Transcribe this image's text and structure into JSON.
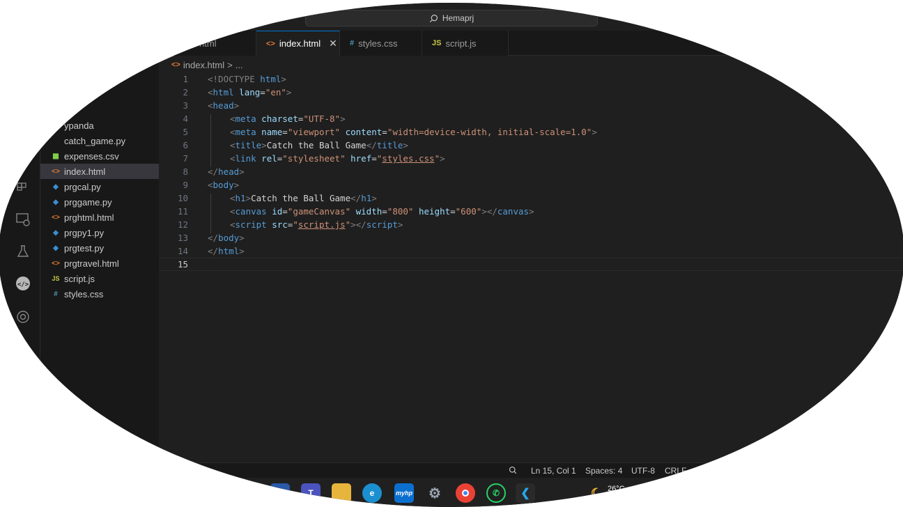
{
  "window": {
    "search_text": "Hemaprj"
  },
  "tabs": [
    {
      "label": "html",
      "icon": "html-file-icon"
    },
    {
      "label": "index.html",
      "icon": "html-file-icon",
      "close": "✕"
    },
    {
      "label": "styles.css",
      "icon": "css-file-icon"
    },
    {
      "label": "script.js",
      "icon": "js-file-icon"
    }
  ],
  "breadcrumb": {
    "file": "index.html",
    "sep": ">",
    "rest": "..."
  },
  "explorer": {
    "files": [
      {
        "label": "ypanda",
        "type": "folder"
      },
      {
        "label": "catch_game.py",
        "type": "py"
      },
      {
        "label": "expenses.csv",
        "type": "csv"
      },
      {
        "label": "index.html",
        "type": "html"
      },
      {
        "label": "prgcal.py",
        "type": "py"
      },
      {
        "label": "prggame.py",
        "type": "py"
      },
      {
        "label": "prghtml.html",
        "type": "html"
      },
      {
        "label": "prgpy1.py",
        "type": "py"
      },
      {
        "label": "prgtest.py",
        "type": "py"
      },
      {
        "label": "prgtravel.html",
        "type": "html"
      },
      {
        "label": "script.js",
        "type": "js"
      },
      {
        "label": "styles.css",
        "type": "css"
      }
    ]
  },
  "editor": {
    "line_numbers": [
      "1",
      "2",
      "3",
      "4",
      "5",
      "6",
      "7",
      "8",
      "9",
      "10",
      "11",
      "12",
      "13",
      "14",
      "15"
    ],
    "code": {
      "l1": {
        "a": "<!DOCTYPE ",
        "b": "html",
        "c": ">"
      },
      "l2": {
        "a": "<",
        "b": "html",
        "c": " lang",
        "d": "=",
        "e": "\"en\"",
        "f": ">"
      },
      "l3": {
        "a": "<",
        "b": "head",
        "c": ">"
      },
      "l4": {
        "a": "<",
        "b": "meta",
        "c": " charset",
        "d": "=",
        "e": "\"UTF-8\"",
        "f": ">"
      },
      "l5": {
        "a": "<",
        "b": "meta",
        "c": " name",
        "d": "=",
        "e": "\"viewport\"",
        "f": " content",
        "g": "=",
        "h": "\"width=device-width, initial-scale=1.0\"",
        "i": ">"
      },
      "l6": {
        "a": "<",
        "b": "title",
        "c": ">",
        "d": "Catch the Ball Game",
        "e": "</",
        "f": "title",
        "g": ">"
      },
      "l7": {
        "a": "<",
        "b": "link",
        "c": " rel",
        "d": "=",
        "e": "\"stylesheet\"",
        "f": " href",
        "g": "=",
        "h": "\"",
        "i": "styles.css",
        "j": "\"",
        "k": ">"
      },
      "l8": {
        "a": "</",
        "b": "head",
        "c": ">"
      },
      "l9": {
        "a": "<",
        "b": "body",
        "c": ">"
      },
      "l10": {
        "a": "<",
        "b": "h1",
        "c": ">",
        "d": "Catch the Ball Game",
        "e": "</",
        "f": "h1",
        "g": ">"
      },
      "l11": {
        "a": "<",
        "b": "canvas",
        "c": " id",
        "d": "=",
        "e": "\"gameCanvas\"",
        "f": " width",
        "g": "=",
        "h": "\"800\"",
        "i": " height",
        "j": "=",
        "k": "\"600\"",
        "l": "></",
        "m": "canvas",
        "n": ">"
      },
      "l12": {
        "a": "<",
        "b": "script",
        "c": " src",
        "d": "=",
        "e": "\"",
        "f": "script.js",
        "g": "\"",
        "h": "></",
        "i": "script",
        "j": ">"
      },
      "l13": {
        "a": "</",
        "b": "body",
        "c": ">"
      },
      "l14": {
        "a": "</",
        "b": "html",
        "c": ">"
      }
    }
  },
  "statusbar": {
    "position": "Ln 15, Col 1",
    "spaces": "Spaces: 4",
    "encoding": "UTF-8",
    "eol": "CRLF",
    "braces": "{}"
  },
  "taskbar": {
    "weather": "26°C",
    "myhp_label": "myhp"
  },
  "colors": {
    "accent": "#0078d4",
    "background": "#1f1f1f"
  }
}
